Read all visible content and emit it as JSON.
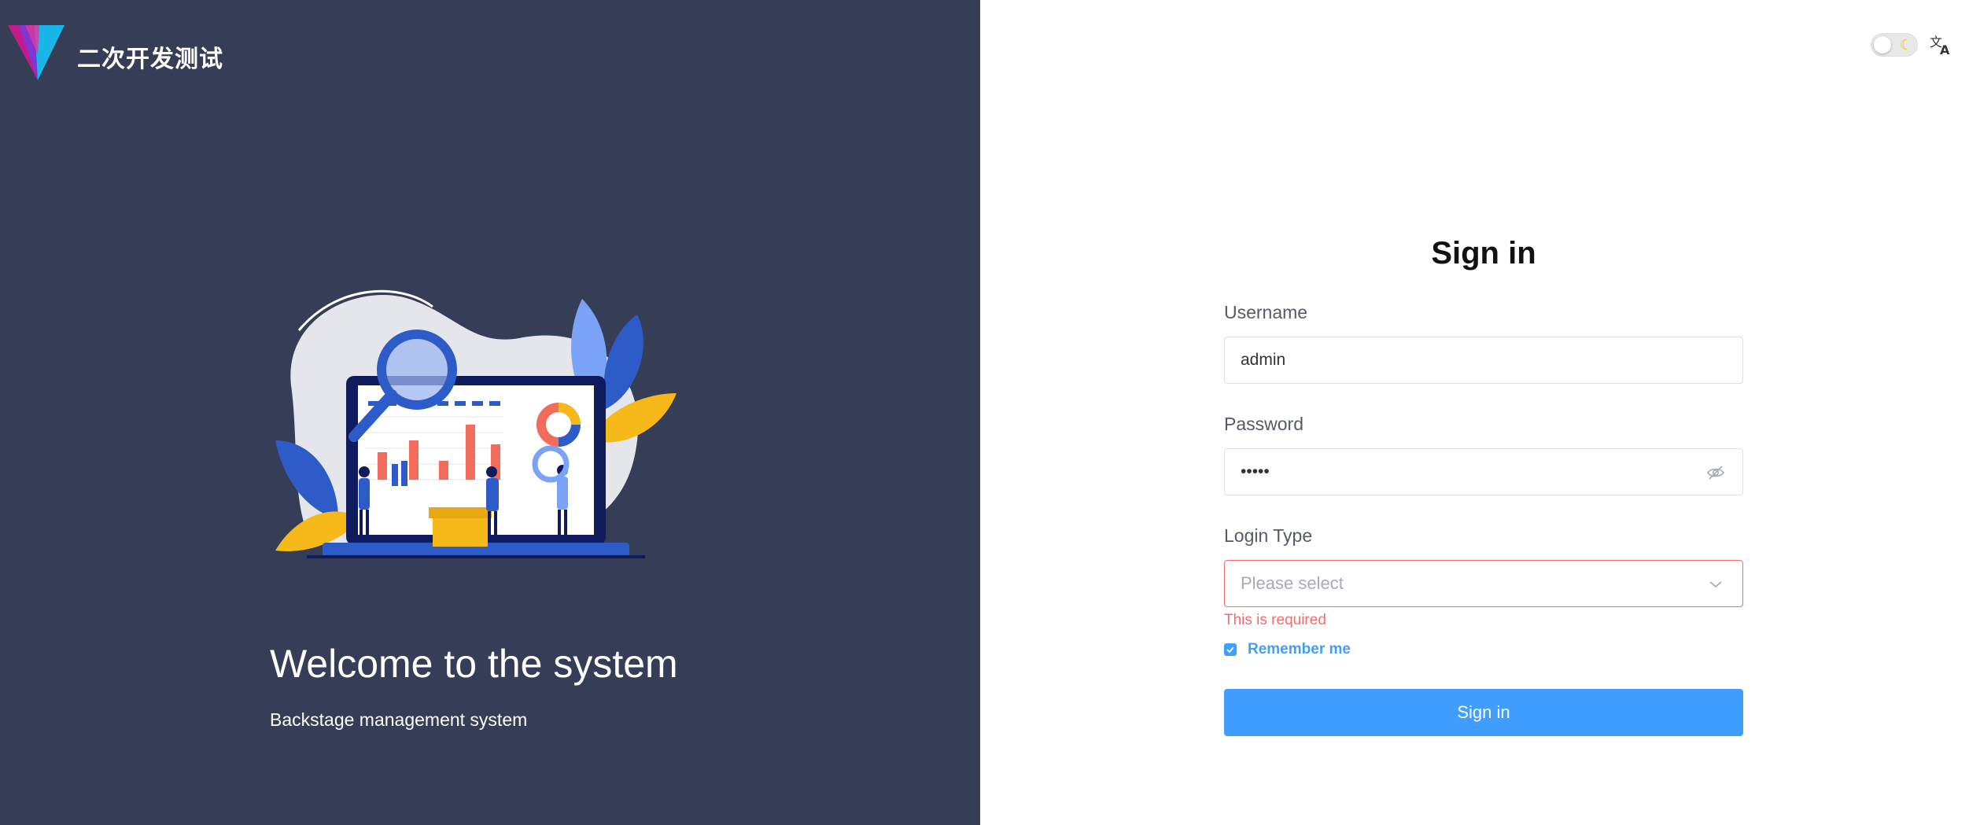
{
  "app": {
    "title": "二次开发测试"
  },
  "welcome": {
    "title": "Welcome to the system",
    "subtitle": "Backstage management system"
  },
  "header": {
    "theme_icon": "moon-icon",
    "translate_icon": "translate-icon"
  },
  "form": {
    "title": "Sign in",
    "username": {
      "label": "Username",
      "value": "admin"
    },
    "password": {
      "label": "Password",
      "value": "•••••"
    },
    "login_type": {
      "label": "Login Type",
      "placeholder": "Please select",
      "error": "This is required"
    },
    "remember": {
      "label": "Remember me",
      "checked": true
    },
    "submit_label": "Sign in"
  },
  "colors": {
    "left_bg": "#363d56",
    "accent": "#409eff",
    "error": "#f56c6c"
  }
}
